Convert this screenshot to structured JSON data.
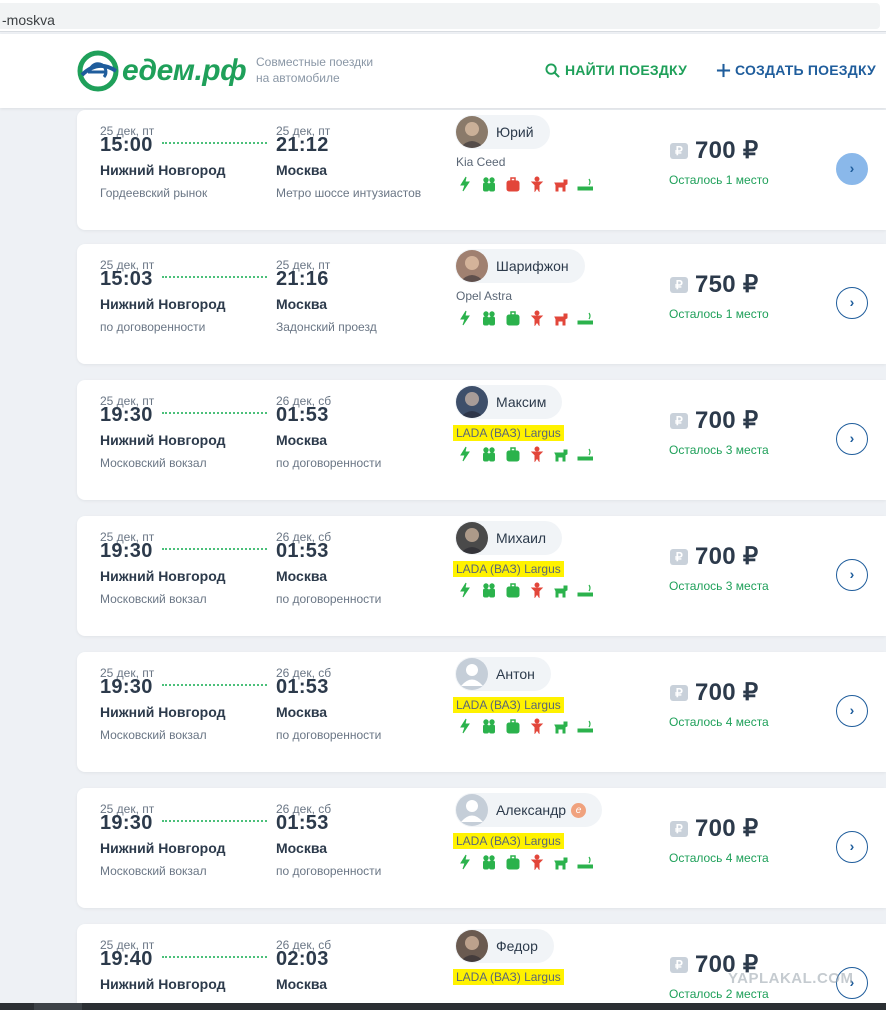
{
  "browser": {
    "url_fragment": "-moskva"
  },
  "header": {
    "logo_text": "едем.рф",
    "tagline_line1": "Совместные поездки",
    "tagline_line2": "на автомобиле",
    "find_label": "НАЙТИ ПОЕЗДКУ",
    "create_label": "СОЗДАТЬ ПОЕЗДКУ"
  },
  "colors": {
    "brand_green": "#1fa05a",
    "brand_blue": "#1f5d9c",
    "highlight": "#fff200",
    "amenity_green": "#2bb24c",
    "amenity_red": "#e2463a"
  },
  "trips": [
    {
      "date_from": "25 дек, пт",
      "time_from": "15:00",
      "city_from": "Нижний Новгород",
      "place_from": "Гордеевский рынок",
      "date_to": "25 дек, пт",
      "time_to": "21:12",
      "city_to": "Москва",
      "place_to": "Метро шоссе интузиастов",
      "driver": "Юрий",
      "car": "Kia Ceed",
      "price": "700",
      "seats": "Осталось 1 место",
      "highlight": false,
      "amenities": [
        "green",
        "green",
        "red",
        "red",
        "red",
        "green"
      ]
    },
    {
      "date_from": "25 дек, пт",
      "time_from": "15:03",
      "city_from": "Нижний Новгород",
      "place_from": "по договоренности",
      "date_to": "25 дек, пт",
      "time_to": "21:16",
      "city_to": "Москва",
      "place_to": "Задонский проезд",
      "driver": "Шарифжон",
      "car": "Opel Astra",
      "price": "750",
      "seats": "Осталось 1 место",
      "highlight": false,
      "amenities": [
        "green",
        "green",
        "green",
        "red",
        "red",
        "green"
      ]
    },
    {
      "date_from": "25 дек, пт",
      "time_from": "19:30",
      "city_from": "Нижний Новгород",
      "place_from": "Московский вокзал",
      "date_to": "26 дек, сб",
      "time_to": "01:53",
      "city_to": "Москва",
      "place_to": "по договоренности",
      "driver": "Максим",
      "car": "LADA (ВАЗ) Largus",
      "price": "700",
      "seats": "Осталось 3 места",
      "highlight": true,
      "amenities": [
        "green",
        "green",
        "green",
        "red",
        "green",
        "green"
      ]
    },
    {
      "date_from": "25 дек, пт",
      "time_from": "19:30",
      "city_from": "Нижний Новгород",
      "place_from": "Московский вокзал",
      "date_to": "26 дек, сб",
      "time_to": "01:53",
      "city_to": "Москва",
      "place_to": "по договоренности",
      "driver": "Михаил",
      "car": "LADA (ВАЗ) Largus",
      "price": "700",
      "seats": "Осталось 3 места",
      "highlight": true,
      "amenities": [
        "green",
        "green",
        "green",
        "red",
        "green",
        "green"
      ]
    },
    {
      "date_from": "25 дек, пт",
      "time_from": "19:30",
      "city_from": "Нижний Новгород",
      "place_from": "Московский вокзал",
      "date_to": "26 дек, сб",
      "time_to": "01:53",
      "city_to": "Москва",
      "place_to": "по договоренности",
      "driver": "Антон",
      "car": "LADA (ВАЗ) Largus",
      "price": "700",
      "seats": "Осталось 4 места",
      "highlight": true,
      "amenities": [
        "green",
        "green",
        "green",
        "red",
        "green",
        "green"
      ]
    },
    {
      "date_from": "25 дек, пт",
      "time_from": "19:30",
      "city_from": "Нижний Новгород",
      "place_from": "Московский вокзал",
      "date_to": "26 дек, сб",
      "time_to": "01:53",
      "city_to": "Москва",
      "place_to": "по договоренности",
      "driver": "Александр",
      "car": "LADA (ВАЗ) Largus",
      "price": "700",
      "seats": "Осталось 4 места",
      "highlight": true,
      "badge": "e",
      "amenities": [
        "green",
        "green",
        "green",
        "red",
        "green",
        "green"
      ]
    },
    {
      "date_from": "25 дек, пт",
      "time_from": "19:40",
      "city_from": "Нижний Новгород",
      "place_from": "",
      "date_to": "26 дек, сб",
      "time_to": "02:03",
      "city_to": "Москва",
      "place_to": "",
      "driver": "Федор",
      "car": "LADA (ВАЗ) Largus",
      "price": "700",
      "seats": "Осталось 2 места",
      "highlight": true,
      "amenities": []
    }
  ],
  "currency_symbol": "₽",
  "watermark": "YAPLAKAL.COM"
}
